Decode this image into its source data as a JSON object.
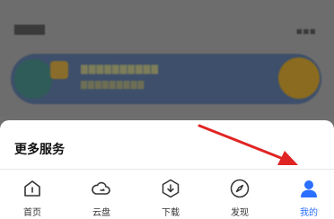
{
  "sheet": {
    "title": "更多服务"
  },
  "tabs": [
    {
      "label": "首页",
      "icon": "home-icon"
    },
    {
      "label": "云盘",
      "icon": "cloud-icon"
    },
    {
      "label": "下载",
      "icon": "download-icon"
    },
    {
      "label": "发现",
      "icon": "compass-icon"
    },
    {
      "label": "我的",
      "icon": "user-icon",
      "active": true
    }
  ],
  "colors": {
    "accent": "#2a6fff",
    "arrow": "#e02424",
    "overlay": "#6f6f6f"
  }
}
